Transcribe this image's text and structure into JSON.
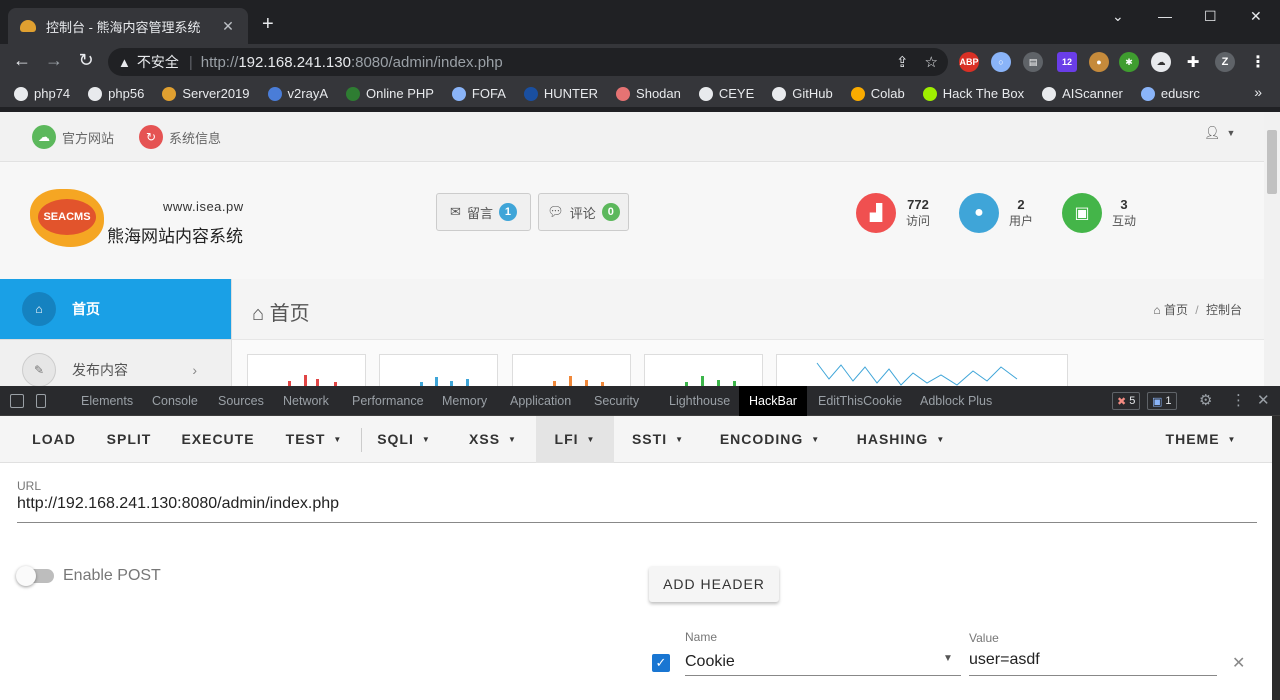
{
  "browser": {
    "tab_title": "控制台 - 熊海内容管理系统",
    "address": {
      "security_label": "不安全",
      "url_prefix": "http://",
      "url_host": "192.168.241.130",
      "url_rest": ":8080/admin/index.php"
    },
    "extension_badge": "12",
    "profile_initial": "Z",
    "bookmarks": [
      "php74",
      "php56",
      "Server2019",
      "v2rayA",
      "Online PHP",
      "FOFA",
      "HUNTER",
      "Shodan",
      "CEYE",
      "GitHub",
      "Colab",
      "Hack The Box",
      "AIScanner",
      "edusrc"
    ],
    "more": "»"
  },
  "page": {
    "topnav": {
      "official_site": "官方网站",
      "system_info": "系统信息"
    },
    "site": {
      "url": "www.isea.pw",
      "name": "熊海网站内容系统",
      "logo_text": "SEACMS"
    },
    "buttons": {
      "message_label": "留言",
      "message_count": "1",
      "comment_label": "评论",
      "comment_count": "0"
    },
    "stats": [
      {
        "value": "772",
        "label": "访问",
        "color": "#f05050"
      },
      {
        "value": "2",
        "label": "用户",
        "color": "#3fa5d8"
      },
      {
        "value": "3",
        "label": "互动",
        "color": "#44b549"
      }
    ],
    "sidebar": {
      "home": "首页",
      "publish": "发布内容"
    },
    "content": {
      "title": "首页",
      "crumb_home": "首页",
      "crumb_sep": "/",
      "crumb_current": "控制台"
    }
  },
  "devtools": {
    "tabs": [
      "Elements",
      "Console",
      "Sources",
      "Network",
      "Performance",
      "Memory",
      "Application",
      "Security",
      "Lighthouse",
      "HackBar",
      "EditThisCookie",
      "Adblock Plus"
    ],
    "active_tab": "HackBar",
    "errors": "5",
    "messages": "1"
  },
  "hackbar": {
    "menu": [
      {
        "label": "LOAD",
        "dropdown": false
      },
      {
        "label": "SPLIT",
        "dropdown": false
      },
      {
        "label": "EXECUTE",
        "dropdown": false
      },
      {
        "label": "TEST",
        "dropdown": true
      },
      {
        "label": "SQLI",
        "dropdown": true
      },
      {
        "label": "XSS",
        "dropdown": true
      },
      {
        "label": "LFI",
        "dropdown": true
      },
      {
        "label": "SSTI",
        "dropdown": true
      },
      {
        "label": "ENCODING",
        "dropdown": true
      },
      {
        "label": "HASHING",
        "dropdown": true
      },
      {
        "label": "THEME",
        "dropdown": true
      }
    ],
    "selected_menu": "LFI",
    "url_label": "URL",
    "url_value": "http://192.168.241.130:8080/admin/index.php",
    "enable_post_label": "Enable POST",
    "enable_post": false,
    "add_header_label": "ADD HEADER",
    "header": {
      "enabled": true,
      "name_label": "Name",
      "name_value": "Cookie",
      "value_label": "Value",
      "value_value": "user=asdf"
    }
  }
}
